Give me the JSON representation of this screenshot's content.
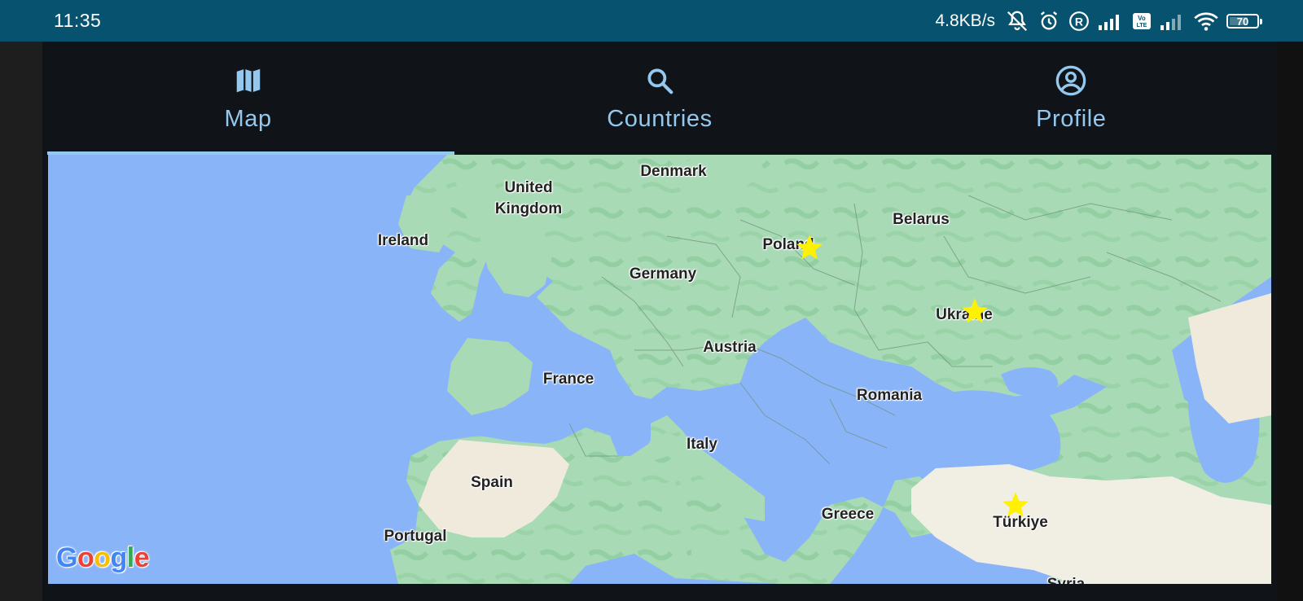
{
  "status_bar": {
    "time": "11:35",
    "net_speed": "4.8KB/s",
    "battery": "70",
    "battery_level": 0.7,
    "icons": [
      "mute-notifications-icon",
      "alarm-icon",
      "registered-icon",
      "signal-icon",
      "volte-icon",
      "signal-icon",
      "wifi-icon",
      "battery-icon"
    ]
  },
  "tabs": [
    {
      "label": "Map",
      "icon": "map-icon",
      "selected": true
    },
    {
      "label": "Countries",
      "icon": "search-icon",
      "selected": false
    },
    {
      "label": "Profile",
      "icon": "account-circle-icon",
      "selected": false
    }
  ],
  "map": {
    "labels": {
      "united_kingdom": "United\nKingdom",
      "ireland": "Ireland",
      "denmark": "Denmark",
      "belarus": "Belarus",
      "poland": "Poland",
      "germany": "Germany",
      "ukraine": "Ukraine",
      "austria": "Austria",
      "france": "France",
      "romania": "Romania",
      "italy": "Italy",
      "spain": "Spain",
      "greece": "Greece",
      "turkiye": "Türkiye",
      "portugal": "Portugal",
      "syria": "Syria"
    },
    "starred_countries": [
      "Poland",
      "Ukraine",
      "Türkiye"
    ],
    "star_color": "#fff200",
    "water_color": "#8ab4f8",
    "land_color": "#a8dab5",
    "attribution": "Google"
  }
}
